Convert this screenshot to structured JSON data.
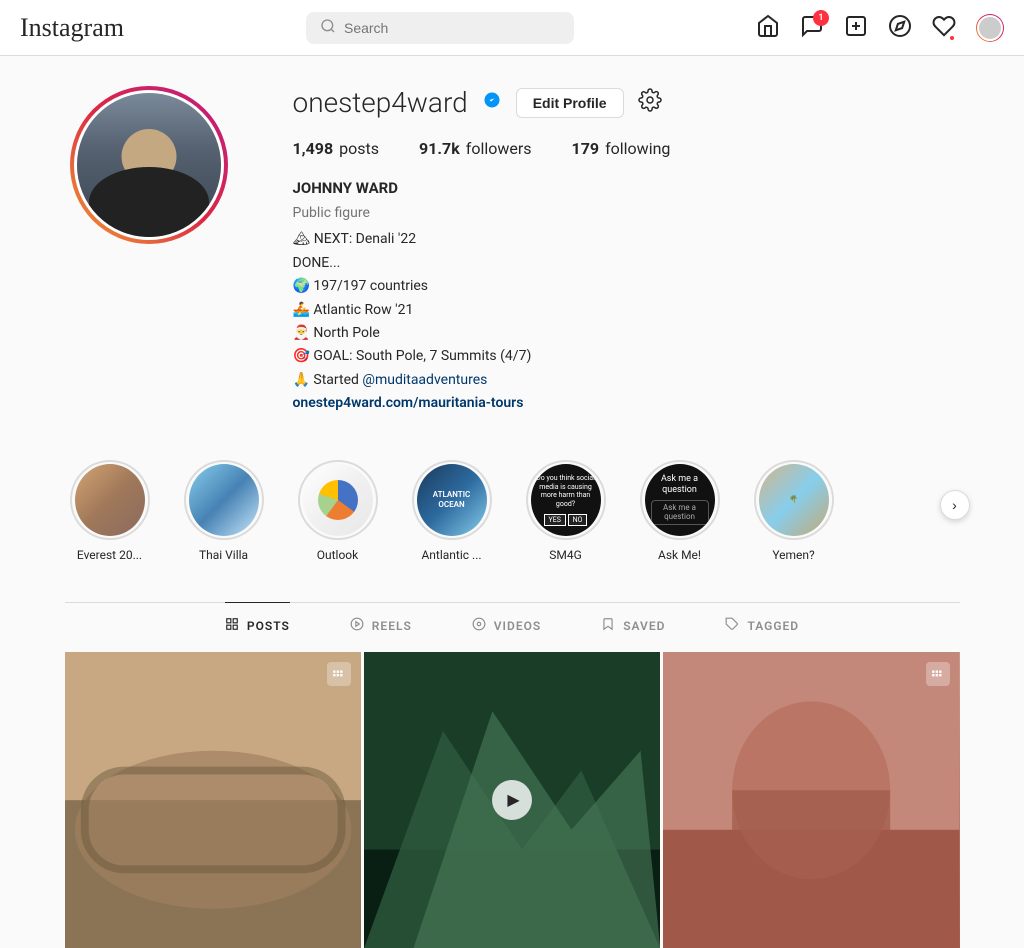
{
  "header": {
    "logo": "Instagram",
    "search_placeholder": "Search",
    "icons": {
      "home": "🏠",
      "messages": "💬",
      "messages_badge": "1",
      "add": "➕",
      "explore": "🧭",
      "heart": "♡"
    }
  },
  "profile": {
    "username": "onestep4ward",
    "verified": true,
    "edit_button": "Edit Profile",
    "stats": {
      "posts_count": "1,498",
      "posts_label": "posts",
      "followers_count": "91.7k",
      "followers_label": "followers",
      "following_count": "179",
      "following_label": "following"
    },
    "bio": {
      "name": "JOHNNY WARD",
      "category": "Public figure",
      "lines": [
        "🏔 NEXT: Denali '22",
        "DONE...",
        "🌍 197/197 countries",
        "🚣 Atlantic Row '21",
        "🎅 North Pole",
        "🎯 GOAL: South Pole, 7 Summits (4/7)",
        "🙏 Started @muditaadventures"
      ],
      "link_text": "onestep4ward.com/mauritania-tours",
      "link_url": "https://onestep4ward.com/mauritania-tours",
      "mention": "@muditaadventures"
    }
  },
  "stories": [
    {
      "id": "everest",
      "label": "Everest 20...",
      "thumb_class": "thumb-everest"
    },
    {
      "id": "thai",
      "label": "Thai Villa",
      "thumb_class": "thumb-thai"
    },
    {
      "id": "outlook",
      "label": "Outlook",
      "thumb_class": "thumb-outlook"
    },
    {
      "id": "atlantic",
      "label": "Antlantic ...",
      "thumb_class": "thumb-atlantic"
    },
    {
      "id": "sm4g",
      "label": "SM4G",
      "thumb_class": "thumb-sm4g"
    },
    {
      "id": "askme",
      "label": "Ask Me!",
      "thumb_class": "thumb-askme"
    },
    {
      "id": "yemen",
      "label": "Yemen?",
      "thumb_class": "thumb-yemen"
    }
  ],
  "tabs": [
    {
      "id": "posts",
      "label": "POSTS",
      "icon": "⊞",
      "active": true
    },
    {
      "id": "reels",
      "label": "REELS",
      "icon": "▶",
      "active": false
    },
    {
      "id": "videos",
      "label": "VIDEOS",
      "icon": "⊙",
      "active": false
    },
    {
      "id": "saved",
      "label": "SAVED",
      "icon": "🔖",
      "active": false
    },
    {
      "id": "tagged",
      "label": "TAGGED",
      "icon": "🏷",
      "active": false
    }
  ],
  "grid": [
    {
      "id": "colosseum",
      "class": "grid-colosseum",
      "has_video": false,
      "has_multi": true
    },
    {
      "id": "amalfi",
      "class": "grid-amalfi",
      "has_video": true,
      "has_multi": false
    },
    {
      "id": "florence",
      "class": "grid-florence",
      "has_video": false,
      "has_multi": true
    }
  ]
}
